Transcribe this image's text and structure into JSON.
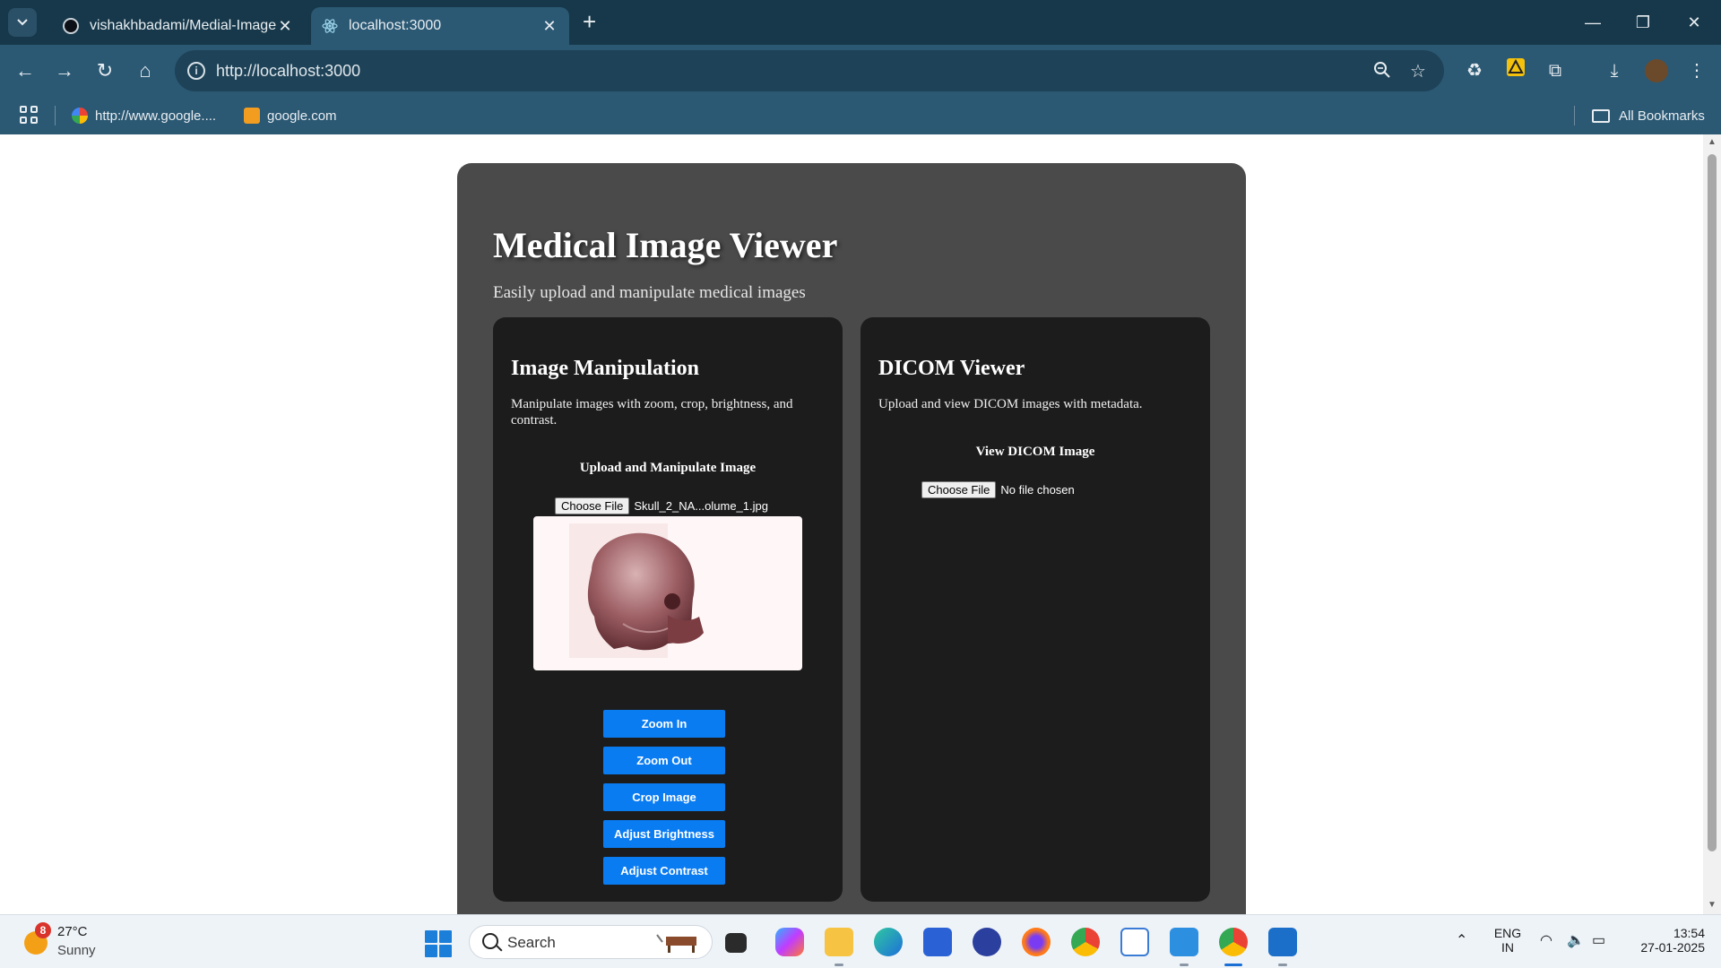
{
  "browser": {
    "tabs": [
      {
        "title": "vishakhbadami/Medial-Image-S",
        "active": false
      },
      {
        "title": "localhost:3000",
        "active": true
      }
    ],
    "url": "http://localhost:3000",
    "bookmarks": [
      {
        "label": "http://www.google...."
      },
      {
        "label": "google.com"
      }
    ],
    "all_bookmarks_label": "All Bookmarks"
  },
  "page": {
    "title": "Medical Image Viewer",
    "subtitle": "Easily upload and manipulate medical images",
    "image_panel": {
      "title": "Image Manipulation",
      "description": "Manipulate images with zoom, crop, brightness, and contrast.",
      "section_heading": "Upload and Manipulate Image",
      "choose_file_label": "Choose File",
      "file_name": "Skull_2_NA...olume_1.jpg",
      "buttons": [
        "Zoom In",
        "Zoom Out",
        "Crop Image",
        "Adjust Brightness",
        "Adjust Contrast"
      ]
    },
    "dicom_panel": {
      "title": "DICOM Viewer",
      "description": "Upload and view DICOM images with metadata.",
      "section_heading": "View DICOM Image",
      "choose_file_label": "Choose File",
      "file_status": "No file chosen"
    }
  },
  "taskbar": {
    "weather": {
      "badge": "8",
      "temp": "27°C",
      "condition": "Sunny"
    },
    "search_label": "Search",
    "language": {
      "line1": "ENG",
      "line2": "IN"
    },
    "clock": {
      "time": "13:54",
      "date": "27-01-2025"
    }
  },
  "colors": {
    "accent_button": "#0a7cf2",
    "card_bg": "#4a4a4a",
    "panel_bg": "#1c1c1c",
    "chrome_bg": "#2b5873"
  }
}
